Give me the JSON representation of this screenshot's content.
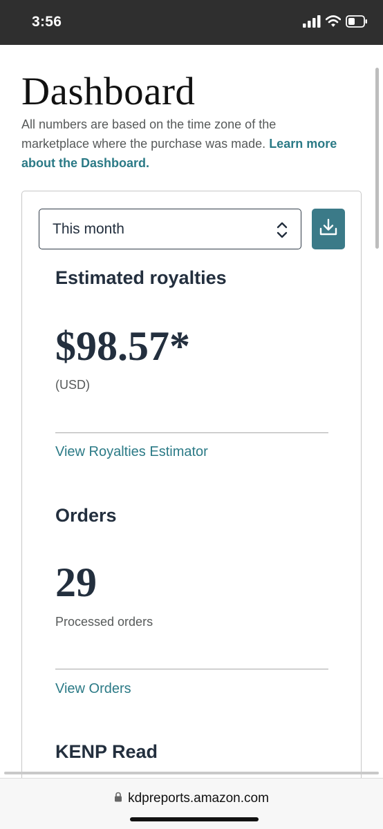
{
  "status_bar": {
    "time": "3:56"
  },
  "page": {
    "title": "Dashboard",
    "intro_text": "All numbers are based on the time zone of the marketplace where the purchase was made. ",
    "intro_link": "Learn more about the Dashboard."
  },
  "filter": {
    "selected_period": "This month"
  },
  "royalties": {
    "heading": "Estimated royalties",
    "value": "$98.57*",
    "currency": "(USD)",
    "link": "View Royalties Estimator"
  },
  "orders": {
    "heading": "Orders",
    "value": "29",
    "label": "Processed orders",
    "link": "View Orders"
  },
  "kenp": {
    "heading": "KENP Read"
  },
  "browser": {
    "url": "kdpreports.amazon.com"
  },
  "colors": {
    "accent_teal": "#3b7a88",
    "link_teal": "#2b7a86",
    "heading_navy": "#232f3e",
    "status_bar": "#2f2f2f"
  },
  "icons": [
    "signal-icon",
    "wifi-icon",
    "battery-icon",
    "updown-icon",
    "download-icon",
    "lock-icon"
  ]
}
